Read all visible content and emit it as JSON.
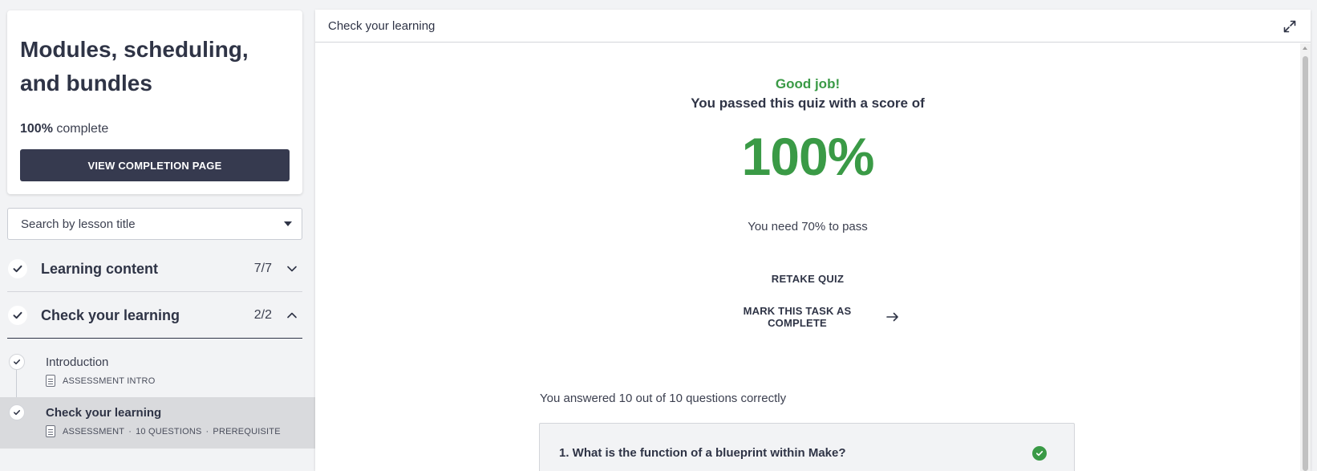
{
  "sidebar": {
    "course_title": "Modules, scheduling, and bundles",
    "progress_value": "100%",
    "progress_suffix": "complete",
    "completion_button": "VIEW COMPLETION PAGE",
    "search_placeholder": "Search by lesson title",
    "sections": [
      {
        "title": "Learning content",
        "count": "7/7",
        "expanded": false
      },
      {
        "title": "Check your learning",
        "count": "2/2",
        "expanded": true
      }
    ],
    "lessons": [
      {
        "title": "Introduction",
        "meta": [
          "ASSESSMENT INTRO"
        ],
        "active": false
      },
      {
        "title": "Check your learning",
        "meta": [
          "ASSESSMENT",
          "10 QUESTIONS",
          "PREREQUISITE"
        ],
        "active": true
      }
    ]
  },
  "main": {
    "header_title": "Check your learning",
    "good_job": "Good job!",
    "passed_text": "You passed this quiz with a score of",
    "score": "100%",
    "need_text": "You need 70% to pass",
    "retake_label": "RETAKE QUIZ",
    "mark_complete_label": "MARK THIS TASK AS COMPLETE",
    "answered_text": "You answered 10 out of 10 questions correctly",
    "questions": [
      {
        "text": "1. What is the function of a blueprint within Make?",
        "correct": true
      }
    ]
  },
  "colors": {
    "accent_green": "#3a9a46",
    "button_dark": "#363a4f",
    "text_primary": "#2f3446"
  },
  "icons": [
    "check-icon",
    "chevron-down-icon",
    "chevron-up-icon",
    "caret-down-icon",
    "document-icon",
    "expand-icon",
    "arrow-right-icon"
  ]
}
